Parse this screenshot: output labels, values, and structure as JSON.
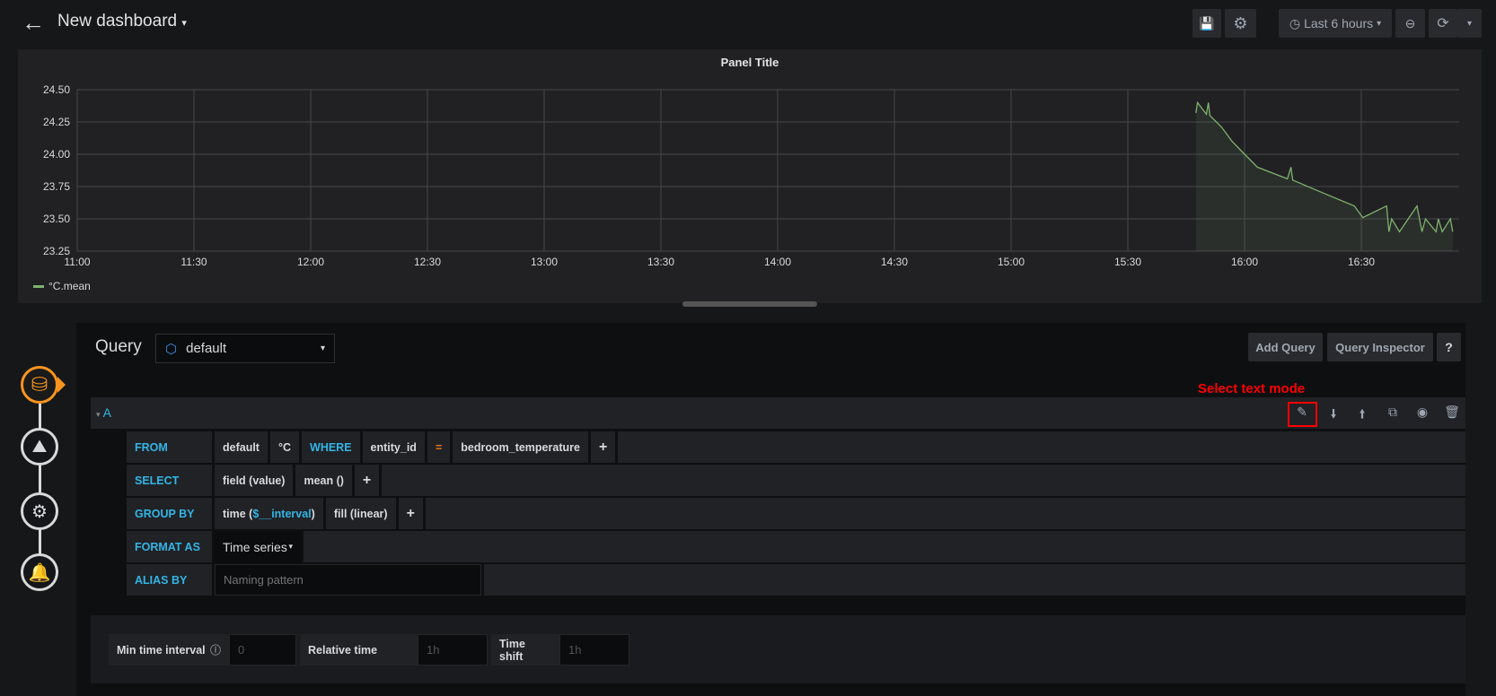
{
  "topbar": {
    "title": "New dashboard",
    "time_range": "Last 6 hours",
    "icons": [
      "arrow-left-icon",
      "save-icon",
      "gear-icon",
      "clock-icon",
      "zoom-out-icon",
      "refresh-icon",
      "caret-down-icon"
    ]
  },
  "panel": {
    "title": "Panel Title",
    "legend": "°C.mean"
  },
  "chart_data": {
    "type": "area",
    "title": "Panel Title",
    "ylim": [
      23.25,
      24.5
    ],
    "yticks": [
      "23.25",
      "23.50",
      "23.75",
      "24.00",
      "24.25",
      "24.50"
    ],
    "xticks": [
      "11:00",
      "11:30",
      "12:00",
      "12:30",
      "13:00",
      "13:30",
      "14:00",
      "14:30",
      "15:00",
      "15:30",
      "16:00",
      "16:30"
    ],
    "grid": true,
    "legend_placement": "bottom-left",
    "series": [
      {
        "name": "°C.mean",
        "color": "#7eb26d",
        "x": [
          "15:47:30",
          "15:47:54",
          "15:50:12",
          "15:50:42",
          "15:51:06",
          "15:54:06",
          "15:56:48",
          "16:00:00",
          "16:03:18",
          "16:11:00",
          "16:11:54",
          "16:12:24",
          "16:20:12",
          "16:28:12",
          "16:30:24",
          "16:36:30",
          "16:37:06",
          "16:37:48",
          "16:39:48",
          "16:44:18",
          "16:45:36",
          "16:46:30",
          "16:49:12",
          "16:49:48",
          "16:50:48",
          "16:52:54",
          "16:53:30"
        ],
        "values": [
          24.32,
          24.4,
          24.31,
          24.4,
          24.3,
          24.21,
          24.1,
          24.0,
          23.9,
          23.81,
          23.9,
          23.8,
          23.7,
          23.6,
          23.51,
          23.6,
          23.4,
          23.5,
          23.4,
          23.6,
          23.4,
          23.5,
          23.4,
          23.5,
          23.4,
          23.5,
          23.4
        ]
      }
    ]
  },
  "query": {
    "label": "Query",
    "datasource": "default",
    "add_query": "Add Query",
    "query_inspector": "Query Inspector",
    "help": "?",
    "annotation": "Select text mode",
    "ref_id": "A",
    "from": {
      "label": "FROM",
      "policy": "default",
      "measurement": "°C",
      "where": "WHERE",
      "tag": "entity_id",
      "op": "=",
      "value": "bedroom_temperature",
      "add": "+"
    },
    "select": {
      "label": "SELECT",
      "field": "field (value)",
      "fn": "mean ()",
      "add": "+"
    },
    "group_by": {
      "label": "GROUP BY",
      "time_pre": "time (",
      "time_var": "$__interval",
      "time_post": ")",
      "fill": "fill (linear)",
      "add": "+"
    },
    "format_as": {
      "label": "FORMAT AS",
      "value": "Time series"
    },
    "alias_by": {
      "label": "ALIAS BY",
      "placeholder": "Naming pattern"
    }
  },
  "options": {
    "min_interval_label": "Min time interval",
    "min_interval_placeholder": "0",
    "relative_label": "Relative time",
    "relative_placeholder": "1h",
    "shift_label": "Time shift",
    "shift_placeholder": "1h"
  },
  "rail": [
    "database-icon",
    "chart-area-icon",
    "settings-icon",
    "bell-icon"
  ]
}
